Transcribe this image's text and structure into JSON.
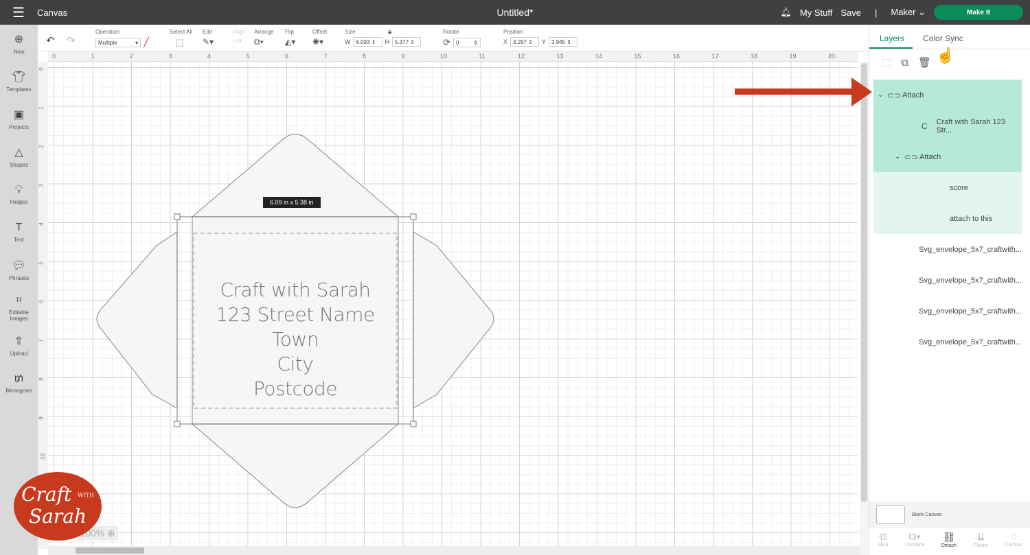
{
  "header": {
    "app": "Canvas",
    "title": "Untitled*",
    "my_stuff": "My Stuff",
    "save": "Save",
    "separator": "|",
    "machine": "Maker",
    "make_it": "Make It"
  },
  "sidebar": [
    {
      "icon": "plus",
      "label": "New"
    },
    {
      "icon": "shirt",
      "label": "Templates"
    },
    {
      "icon": "projects",
      "label": "Projects"
    },
    {
      "icon": "shapes",
      "label": "Shapes"
    },
    {
      "icon": "bulb",
      "label": "Images"
    },
    {
      "icon": "T",
      "label": "Text"
    },
    {
      "icon": "speech",
      "label": "Phrases"
    },
    {
      "icon": "editable",
      "label": "Editable Images"
    },
    {
      "icon": "upload",
      "label": "Upload"
    },
    {
      "icon": "monogram",
      "label": "Monogram"
    }
  ],
  "toolbar": {
    "operation_label": "Operation",
    "operation_value": "Multiple",
    "select_all": "Select All",
    "edit": "Edit",
    "align": "Align",
    "arrange": "Arrange",
    "flip": "Flip",
    "offset": "Offset",
    "size": "Size",
    "w_label": "W",
    "w": "6.093",
    "h_label": "H",
    "h": "5.377",
    "rotate": "Rotate",
    "rotate_value": "0",
    "position": "Position",
    "x_label": "X",
    "x": "3.297",
    "y_label": "Y",
    "y": "3.945"
  },
  "ruler_h": [
    "0",
    "1",
    "2",
    "3",
    "4",
    "5",
    "6",
    "7",
    "8",
    "9",
    "10",
    "11",
    "12",
    "13",
    "14",
    "15",
    "16",
    "17",
    "18",
    "19",
    "20"
  ],
  "ruler_v": [
    "0",
    "1",
    "2",
    "3",
    "4",
    "5",
    "6",
    "7",
    "8",
    "9",
    "10"
  ],
  "canvas": {
    "dimension_tag": "6.09  in x 5.38  in",
    "address_lines": [
      "Craft with Sarah",
      "123 Street Name",
      "Town",
      "City",
      "Postcode"
    ],
    "zoom": "100%"
  },
  "logo": {
    "line1": "Craft",
    "with": "WITH",
    "line2": "Sarah",
    "color": "#c73a1e"
  },
  "panel": {
    "tabs": [
      "Layers",
      "Color Sync"
    ],
    "layers": [
      {
        "label": "Attach",
        "level": 0,
        "icon": "attach",
        "chev": "⌄",
        "style": "g1"
      },
      {
        "label": "Craft with Sarah 123 Str...",
        "level": 2,
        "icon": "C",
        "chev": "",
        "style": "g1"
      },
      {
        "label": "Attach",
        "level": 1,
        "icon": "attach",
        "chev": "⌄",
        "style": "g1"
      },
      {
        "label": "score",
        "level": 3,
        "icon": "",
        "chev": "",
        "style": "g2"
      },
      {
        "label": "attach to this",
        "level": 3,
        "icon": "",
        "chev": "",
        "style": "g2"
      },
      {
        "label": "Svg_envelope_5x7_craftwith...",
        "level": 1,
        "icon": "",
        "chev": "",
        "style": ""
      },
      {
        "label": "Svg_envelope_5x7_craftwith...",
        "level": 1,
        "icon": "",
        "chev": "",
        "style": ""
      },
      {
        "label": "Svg_envelope_5x7_craftwith...",
        "level": 1,
        "icon": "",
        "chev": "",
        "style": ""
      },
      {
        "label": "Svg_envelope_5x7_craftwith...",
        "level": 1,
        "icon": "",
        "chev": "",
        "style": ""
      }
    ],
    "blank_canvas": "Blank Canvas",
    "bottom_tools": [
      "Slice",
      "Combine",
      "Detach",
      "Flatten",
      "Contour"
    ]
  },
  "colors": {
    "accent": "#0b8a5a",
    "arrow": "#c73a1e"
  }
}
